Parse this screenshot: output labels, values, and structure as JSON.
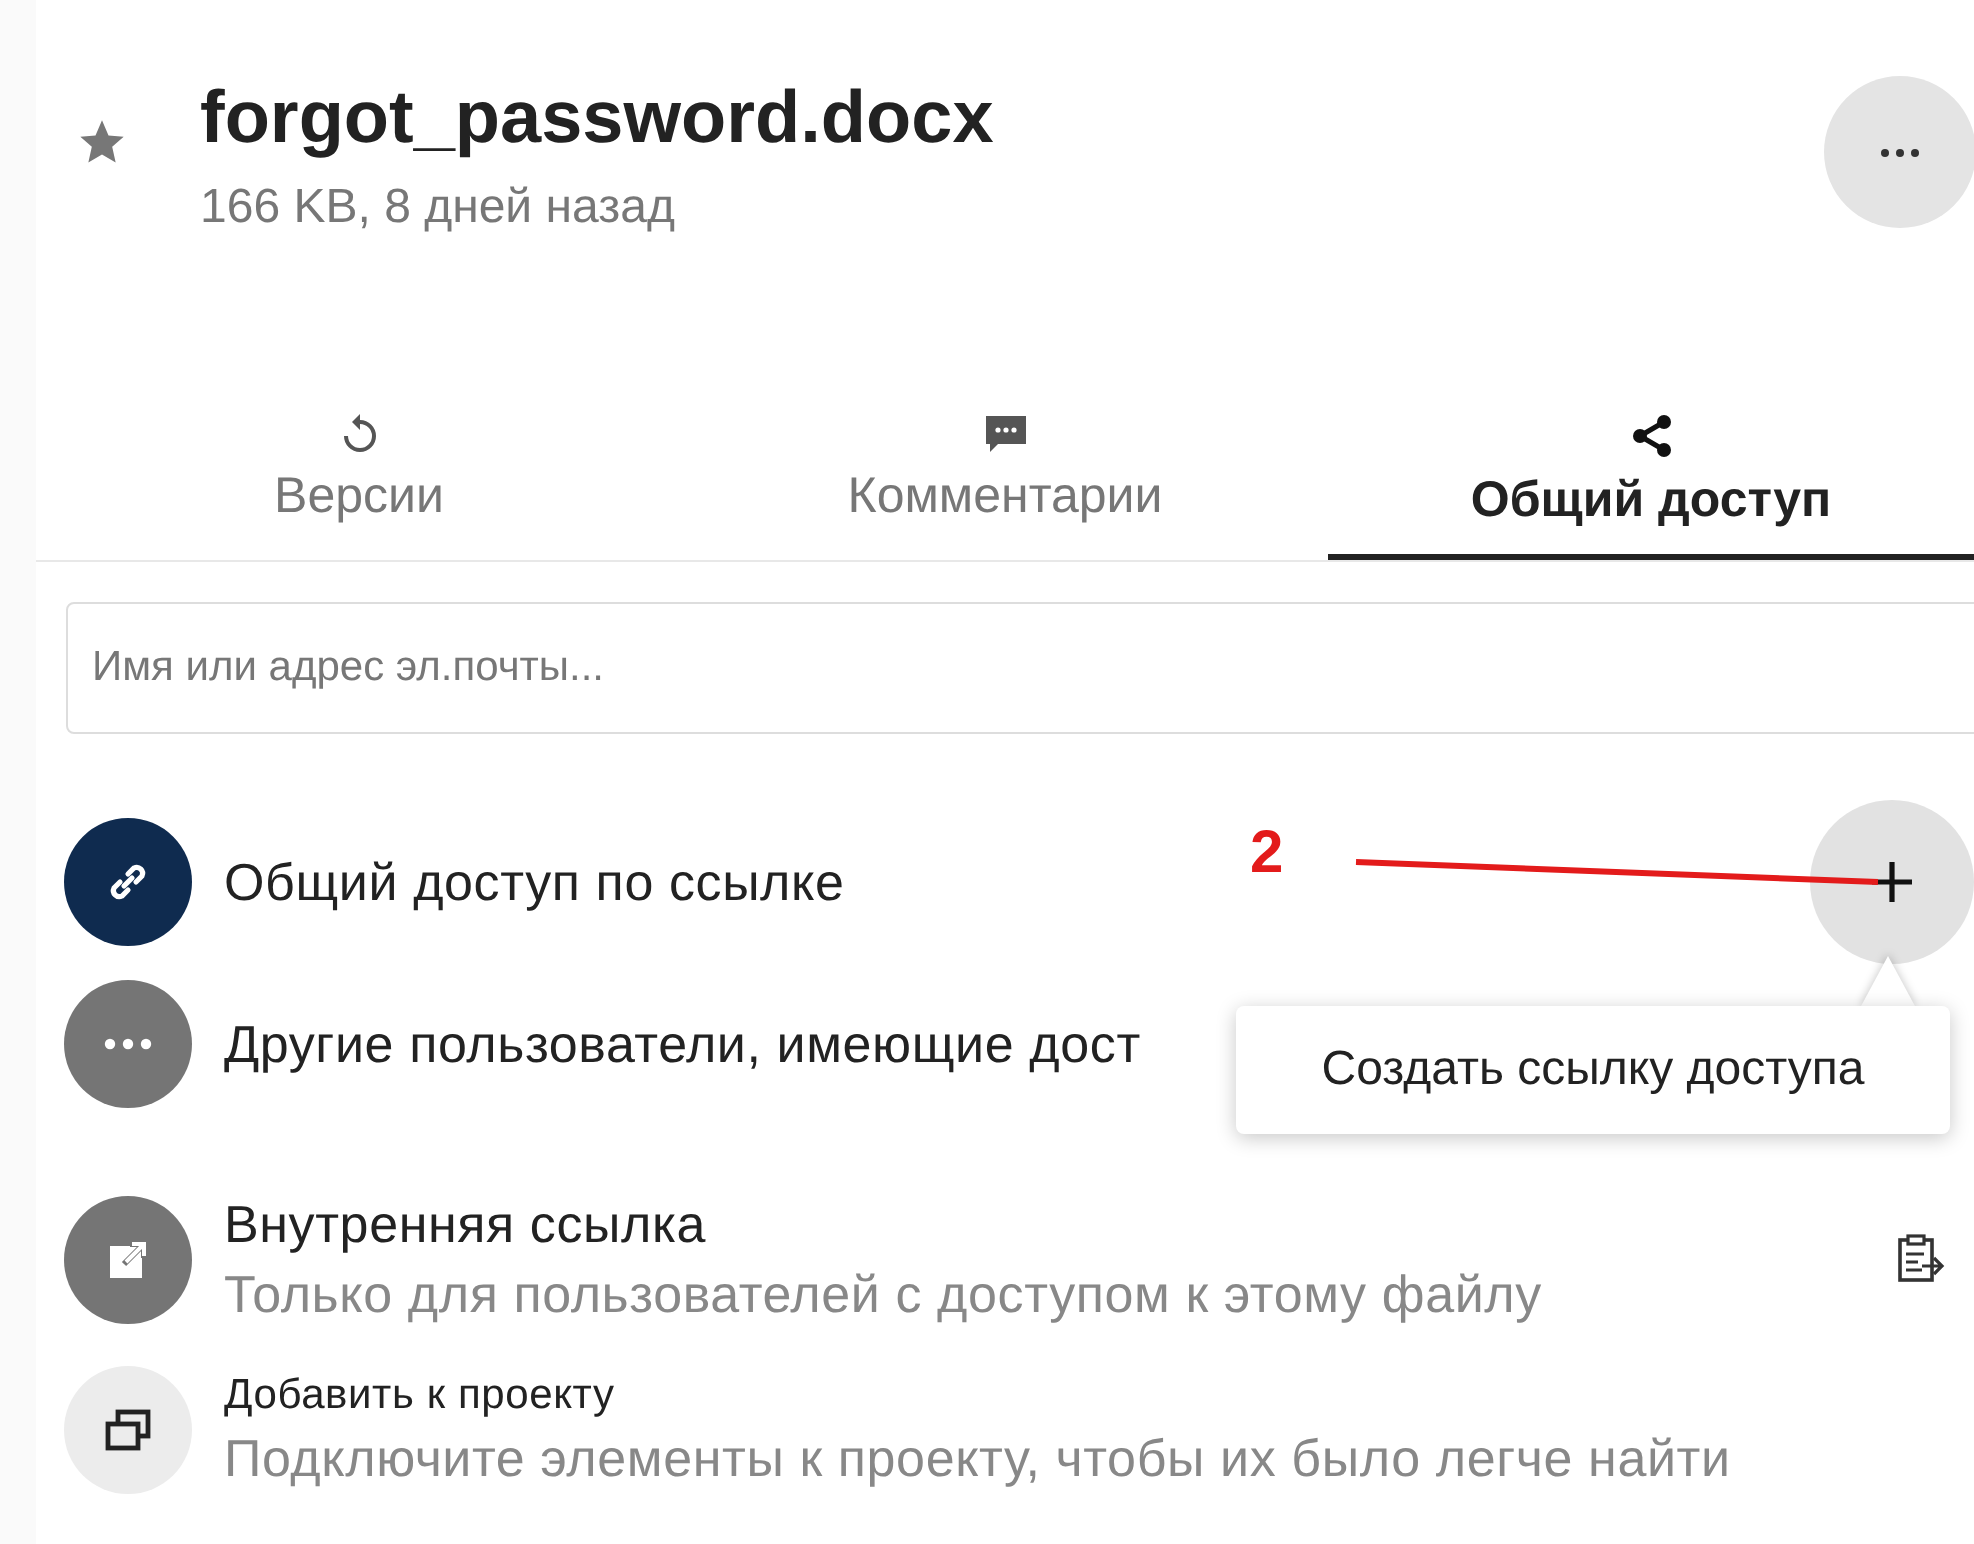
{
  "file": {
    "name": "forgot_password.docx",
    "meta": "166 KB, 8 дней назад",
    "favorite": true
  },
  "tabs": [
    {
      "label": "Версии",
      "kind": "history",
      "selected": false
    },
    {
      "label": "Комментарии",
      "kind": "comment",
      "selected": false
    },
    {
      "label": "Общий доступ",
      "kind": "share",
      "selected": true
    }
  ],
  "search": {
    "placeholder": "Имя или адрес эл.почты..."
  },
  "rows": [
    {
      "kind": "link",
      "title": "Общий доступ по ссылке"
    },
    {
      "kind": "others",
      "title": "Другие пользователи, имеющие дост"
    },
    {
      "kind": "internal",
      "title": "Внутренняя ссылка",
      "subtitle": "Только для пользователей с доступом к этому файлу"
    },
    {
      "kind": "project",
      "title": "Добавить к проекту",
      "subtitle": "Подключите элементы к проекту, чтобы их было легче найти"
    }
  ],
  "tooltip": "Создать ссылку доступа",
  "annotation": "2"
}
